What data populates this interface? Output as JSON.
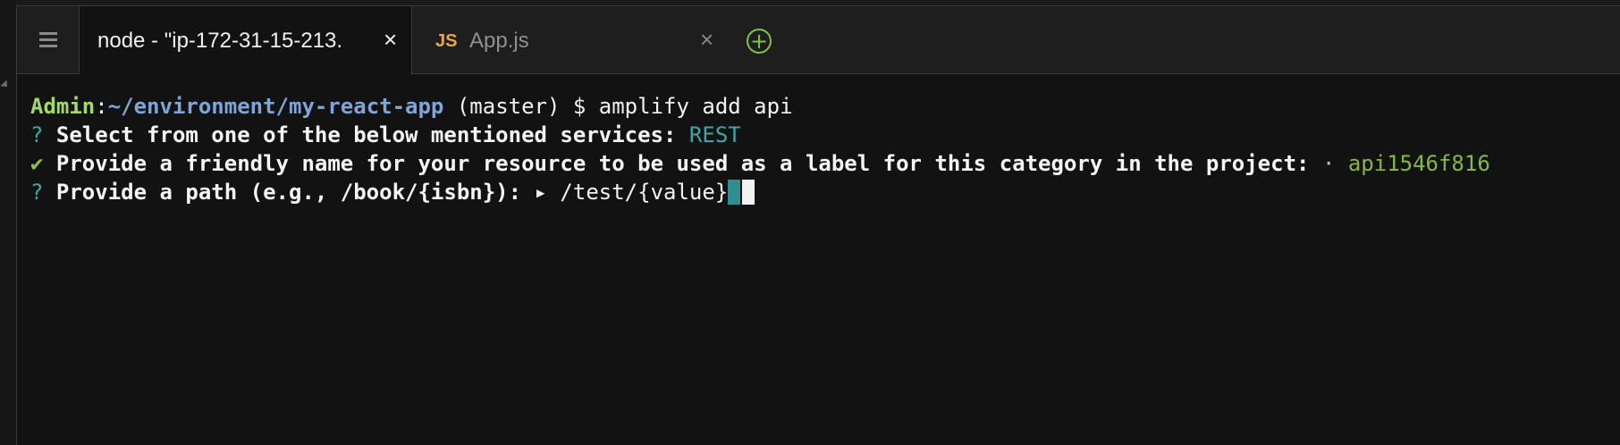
{
  "tabs": [
    {
      "title": "node - \"ip-172-31-15-213.",
      "close": "×",
      "active": true
    },
    {
      "badge": "JS",
      "title": "App.js",
      "close": "×",
      "active": false
    }
  ],
  "new_tab_symbol": "+",
  "terminal": {
    "prompt_user": "Admin",
    "prompt_colon": ":",
    "prompt_path": "~/environment/my-react-app",
    "prompt_rest": " (master) $ amplify add api",
    "line2_mark": "?",
    "line2_text": " Select from one of the below mentioned services: ",
    "line2_answer": "REST",
    "line3_mark": "✔",
    "line3_text": " Provide a friendly name for your resource to be used as a label for this category in the project: ",
    "line3_sep": "·",
    "line3_answer": " api1546f816",
    "line4_mark": "?",
    "line4_text": " Provide a path (e.g., /book/{isbn}): ",
    "line4_arrow": "▸",
    "line4_input": " /test/{value}"
  },
  "colors": {
    "user": "#a5d86a",
    "path": "#7ea4d8",
    "accent_teal": "#3ea7a5",
    "accent_green": "#85b83f",
    "js_badge": "#e8a74a",
    "new_tab": "#7ec24a"
  },
  "icons": {
    "menu": "hamburger-icon",
    "close": "close-icon",
    "new_tab": "plus-circle-icon"
  }
}
